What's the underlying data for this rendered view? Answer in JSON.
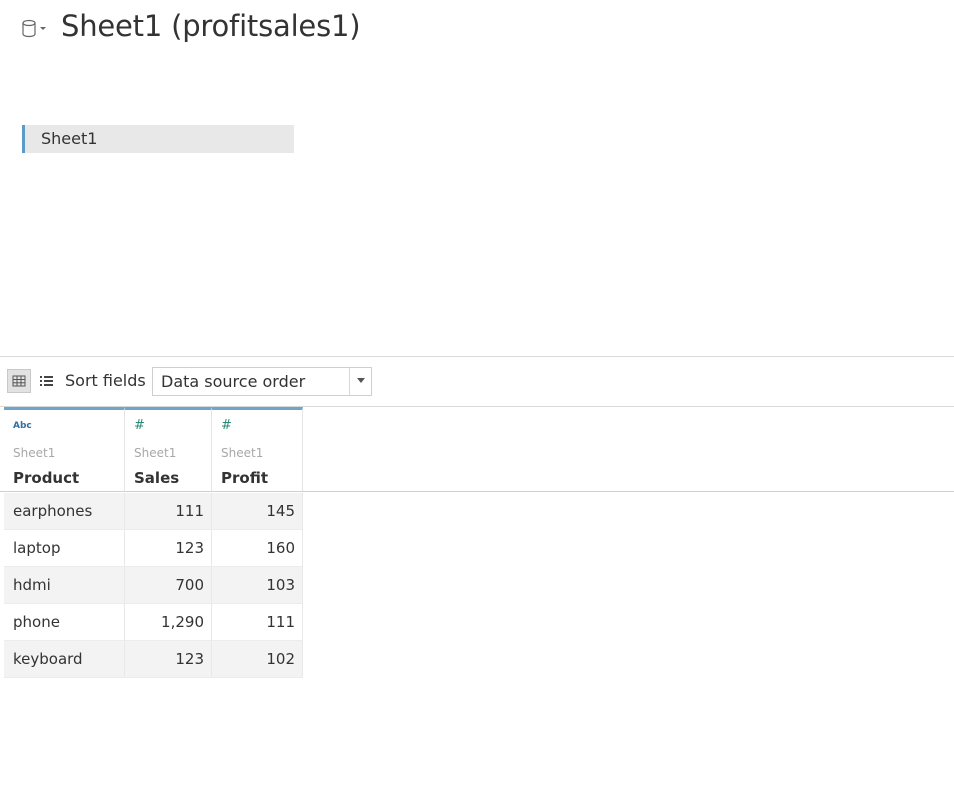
{
  "header": {
    "title": "Sheet1 (profitsales1)",
    "icon": "database-icon"
  },
  "canvas": {
    "table_label": "Sheet1"
  },
  "toolbar": {
    "grid_icon": "grid-view-icon",
    "list_icon": "list-view-icon",
    "sort_label": "Sort fields",
    "sort_value": "Data source order"
  },
  "grid": {
    "columns": [
      {
        "type_icon": "Abc",
        "source": "Sheet1",
        "name": "Product"
      },
      {
        "type_icon": "#",
        "source": "Sheet1",
        "name": "Sales"
      },
      {
        "type_icon": "#",
        "source": "Sheet1",
        "name": "Profit"
      }
    ],
    "rows": [
      [
        "earphones",
        "111",
        "145"
      ],
      [
        "laptop",
        "123",
        "160"
      ],
      [
        "hdmi",
        "700",
        "103"
      ],
      [
        "phone",
        "1,290",
        "111"
      ],
      [
        "keyboard",
        "123",
        "102"
      ]
    ]
  },
  "colors": {
    "accent": "#5b9bc8",
    "string_type": "#2f6fa3",
    "number_type": "#2b8a74"
  }
}
